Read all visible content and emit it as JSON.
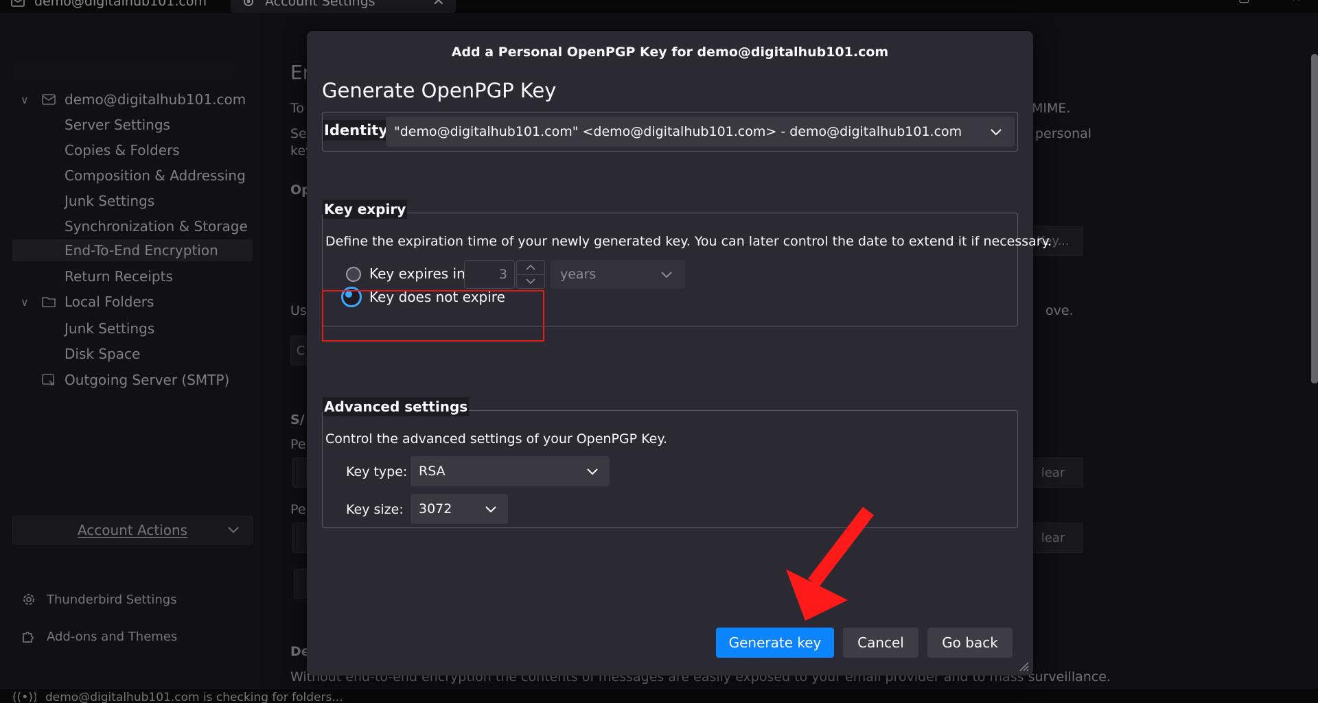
{
  "tabs": [
    {
      "label": "demo@digitalhub101.com"
    },
    {
      "label": "Account Settings",
      "close": "✕"
    }
  ],
  "sidebar": {
    "account": "demo@digitalhub101.com",
    "account_items": [
      "Server Settings",
      "Copies & Folders",
      "Composition & Addressing",
      "Junk Settings",
      "Synchronization & Storage",
      "End-To-End Encryption",
      "Return Receipts"
    ],
    "selected_item": "End-To-End Encryption",
    "local_folders": "Local Folders",
    "local_items": [
      "Junk Settings",
      "Disk Space"
    ],
    "outgoing": "Outgoing Server (SMTP)",
    "account_actions": "Account Actions",
    "thunderbird_settings": "Thunderbird Settings",
    "addons": "Add-ons and Themes"
  },
  "background": {
    "heading_partial": "En",
    "line1_start": "To",
    "line1_end": "MIME.",
    "line2_start": "Sel",
    "line2_end": "personal",
    "line3_start": "key",
    "op_partial": "Op",
    "key_btn": "Key...",
    "use_start": "Us",
    "use_end": "ove.",
    "btn_c": "C",
    "smime_partial": "S/",
    "per1": "Per",
    "per2": "Per",
    "clear1": "lear",
    "clear2": "lear",
    "de_partial": "De",
    "footer_text": "Without end-to-end encryption the contents of messages are easily exposed to your email provider and to mass surveillance."
  },
  "dialog": {
    "title": "Add a Personal OpenPGP Key for demo@digitalhub101.com",
    "heading": "Generate OpenPGP Key",
    "identity_label": "Identity",
    "identity_value": "\"demo@digitalhub101.com\" <demo@digitalhub101.com> - demo@digitalhub101.com",
    "expiry_legend": "Key expiry",
    "expiry_desc": "Define the expiration time of your newly generated key. You can later control the date to extend it if necessary.",
    "option_expires": "Key expires in",
    "expires_value": "3",
    "expires_unit": "years",
    "option_no_expire": "Key does not expire",
    "advanced_legend": "Advanced settings",
    "advanced_desc": "Control the advanced settings of your OpenPGP Key.",
    "key_type_label": "Key type:",
    "key_type_value": "RSA",
    "key_size_label": "Key size:",
    "key_size_value": "3072",
    "generate_btn": "Generate key",
    "cancel_btn": "Cancel",
    "goback_btn": "Go back"
  },
  "statusbar": {
    "text": "demo@digitalhub101.com is checking for folders..."
  },
  "colors": {
    "accent": "#0b84ff",
    "annotation_red": "#e01b1b",
    "dialog_bg": "#2b2a33",
    "page_bg": "#1c1b22"
  }
}
